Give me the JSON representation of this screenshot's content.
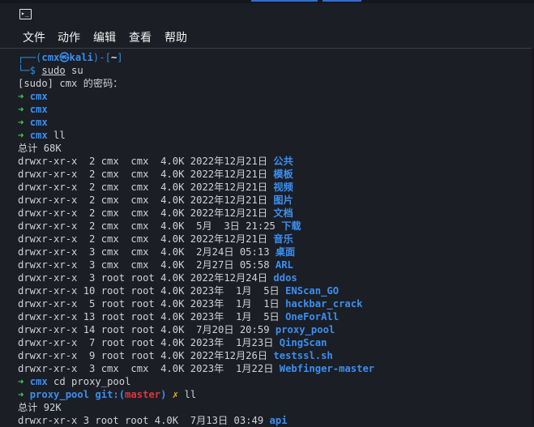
{
  "window": {
    "icon": "terminal-icon",
    "icon_glyph": "▸_"
  },
  "menu": [
    "文件",
    "动作",
    "编辑",
    "查看",
    "帮助"
  ],
  "prompt": {
    "line1_a": "┌──(",
    "user_host": "cmx㉿kali",
    "line1_b": ")-[",
    "cwd": "~",
    "line1_c": "]",
    "line2_a": "└─$ ",
    "cmd": "sudo",
    "cmd_rest": " su"
  },
  "sudo_prompt": "[sudo] cmx 的密码：",
  "root_prompts": [
    {
      "arrow": "➜",
      "dir": "cmx",
      "cmd": ""
    },
    {
      "arrow": "➜",
      "dir": "cmx",
      "cmd": ""
    },
    {
      "arrow": "➜",
      "dir": "cmx",
      "cmd": ""
    },
    {
      "arrow": "➜",
      "dir": "cmx",
      "cmd": " ll"
    }
  ],
  "total1": "总计 68K",
  "listing1": [
    {
      "meta": "drwxr-xr-x  2 cmx  cmx  4.0K 2022年12月21日 ",
      "name": "公共"
    },
    {
      "meta": "drwxr-xr-x  2 cmx  cmx  4.0K 2022年12月21日 ",
      "name": "模板"
    },
    {
      "meta": "drwxr-xr-x  2 cmx  cmx  4.0K 2022年12月21日 ",
      "name": "视频"
    },
    {
      "meta": "drwxr-xr-x  2 cmx  cmx  4.0K 2022年12月21日 ",
      "name": "图片"
    },
    {
      "meta": "drwxr-xr-x  2 cmx  cmx  4.0K 2022年12月21日 ",
      "name": "文档"
    },
    {
      "meta": "drwxr-xr-x  2 cmx  cmx  4.0K  5月  3日 21:25 ",
      "name": "下载"
    },
    {
      "meta": "drwxr-xr-x  2 cmx  cmx  4.0K 2022年12月21日 ",
      "name": "音乐"
    },
    {
      "meta": "drwxr-xr-x  3 cmx  cmx  4.0K  2月24日 05:13 ",
      "name": "桌面"
    },
    {
      "meta": "drwxr-xr-x  3 cmx  cmx  4.0K  2月27日 05:58 ",
      "name": "ARL"
    },
    {
      "meta": "drwxr-xr-x  3 root root 4.0K 2022年12月24日 ",
      "name": "ddos"
    },
    {
      "meta": "drwxr-xr-x 10 root root 4.0K 2023年  1月  5日 ",
      "name": "ENScan_GO"
    },
    {
      "meta": "drwxr-xr-x  5 root root 4.0K 2023年  1月  1日 ",
      "name": "hackbar_crack"
    },
    {
      "meta": "drwxr-xr-x 13 root root 4.0K 2023年  1月  5日 ",
      "name": "OneForAll"
    },
    {
      "meta": "drwxr-xr-x 14 root root 4.0K  7月20日 20:59 ",
      "name": "proxy_pool"
    },
    {
      "meta": "drwxr-xr-x  7 root root 4.0K 2023年  1月23日 ",
      "name": "QingScan"
    },
    {
      "meta": "drwxr-xr-x  9 root root 4.0K 2022年12月26日 ",
      "name": "testssl.sh"
    },
    {
      "meta": "drwxr-xr-x  3 cmx  cmx  4.0K 2023年  1月22日 ",
      "name": "Webfinger-master"
    }
  ],
  "cd_prompt": {
    "arrow": "➜",
    "dir": "cmx",
    "cmd": " cd proxy_pool"
  },
  "git_prompt": {
    "arrow": "➜",
    "dir": "proxy_pool",
    "git": " git:(",
    "branch": "master",
    "git_end": ")",
    "dirty": " ✗",
    "cmd": " ll"
  },
  "total2": "总计 92K",
  "listing2": [
    {
      "meta": "drwxr-xr-x 3 root root 4.0K  7月13日 03:49 ",
      "name": "api"
    }
  ]
}
